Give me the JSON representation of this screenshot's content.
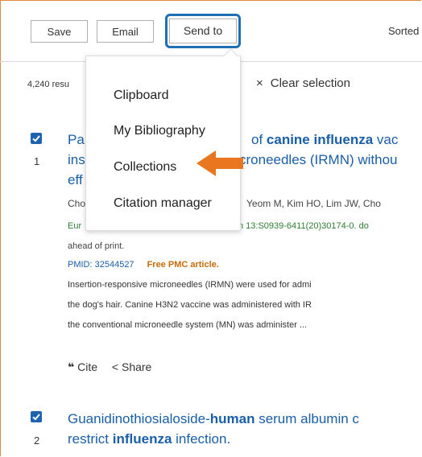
{
  "toolbar": {
    "save_label": "Save",
    "email_label": "Email",
    "send_to_label": "Send to",
    "sorted_label": "Sorted"
  },
  "results": {
    "count_text": "4,240 resu",
    "clear_selection": "Clear selection",
    "clear_icon": "×"
  },
  "send_menu": {
    "items": [
      {
        "label": "Clipboard"
      },
      {
        "label": "My Bibliography"
      },
      {
        "label": "Collections"
      },
      {
        "label": "Citation manager"
      }
    ]
  },
  "articles": [
    {
      "number": "1",
      "title_lines": [
        "Pa",
        "ins",
        "eff"
      ],
      "title_suffix_1_pre": "of ",
      "title_suffix_1_bold": "canine influenza",
      "title_suffix_1_post": " vac",
      "title_suffix_2": "croneedles (IRMN) withou",
      "authors_left": "Cho",
      "authors_right": "Yeom M, Kim HO, Lim JW, Cho",
      "journal_left": "Eur",
      "journal_right": "n 13:S0939-6411(20)30174-0. do",
      "ahead_of_print": "ahead of print.",
      "pmid": "PMID: 32544527",
      "free_pmc": "Free PMC article.",
      "snippet_lines": [
        "Insertion-responsive microneedles (IRMN) were used for admi",
        "the dog's hair. Canine H3N2 vaccine was administered with IR",
        "the conventional microneedle system (MN) was administer ..."
      ],
      "cite_label": "Cite",
      "share_label": "Share"
    },
    {
      "number": "2",
      "title_line1_pre": "Guanidinothiosialoside-",
      "title_line1_bold": "human",
      "title_line1_post": " serum albumin c",
      "title_line2_pre": "restrict ",
      "title_line2_bold": "influenza",
      "title_line2_post": " infection."
    }
  ],
  "colors": {
    "accent_blue": "#1f6fb5",
    "link_blue": "#1a5ea8",
    "annotation_orange": "#e8771f",
    "free_pmc_orange": "#c66d0b"
  },
  "icons": {
    "cite": "quote-icon",
    "share": "share-icon",
    "checkbox": "checkbox-checked-icon",
    "annotation": "orange-arrow-icon"
  }
}
